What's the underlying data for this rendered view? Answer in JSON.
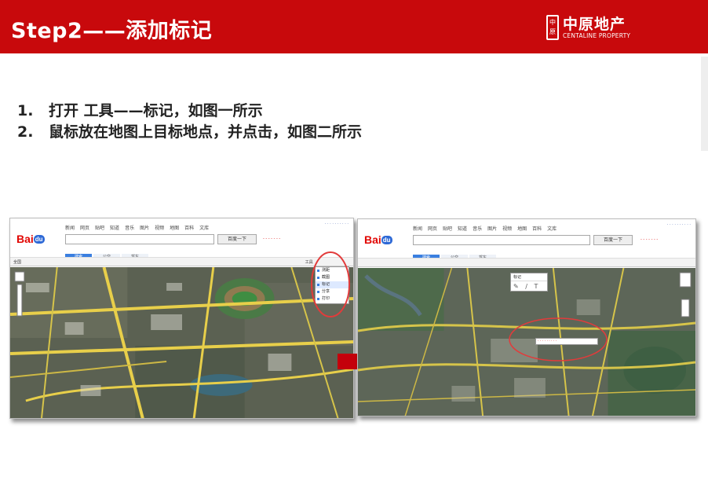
{
  "header": {
    "title": "Step2——添加标记",
    "logo_mark": "中原",
    "logo_cn": "中原地产",
    "logo_en": "CENTALINE PROPERTY"
  },
  "steps": [
    {
      "num": "1.",
      "text": "打开 工具——标记，如图一所示"
    },
    {
      "num": "2.",
      "text": "鼠标放在地图上目标地点，并点击，如图二所示"
    }
  ],
  "screenshot1": {
    "logo": {
      "bai": "Bai",
      "du": "du",
      "map": "地图"
    },
    "nav_links": [
      "新闻",
      "网页",
      "贴吧",
      "知道",
      "音乐",
      "图片",
      "视频",
      "地图",
      "百科",
      "文库"
    ],
    "search_button": "百度一下",
    "tabs": [
      "搜索",
      "公交",
      "驾车"
    ],
    "toolbar_left": "全国",
    "toolbar_tools": "工具",
    "tools_menu": [
      "测距",
      "截图",
      "标记",
      "分享",
      "打印"
    ],
    "tools_menu_selected": 2
  },
  "screenshot2": {
    "logo": {
      "bai": "Bai",
      "du": "du",
      "map": "地图"
    },
    "nav_links": [
      "新闻",
      "网页",
      "贴吧",
      "知道",
      "音乐",
      "图片",
      "视频",
      "地图",
      "百科",
      "文库"
    ],
    "search_button": "百度一下",
    "tabs": [
      "搜索",
      "公交",
      "驾车"
    ],
    "popup_title": "标记",
    "popup_icons": "✎ ∕ T"
  },
  "colors": {
    "header_red": "#c8090c",
    "arrow_red": "#c4000b",
    "annotation_red": "#e23b3b",
    "baidu_blue": "#3a7fe0"
  }
}
